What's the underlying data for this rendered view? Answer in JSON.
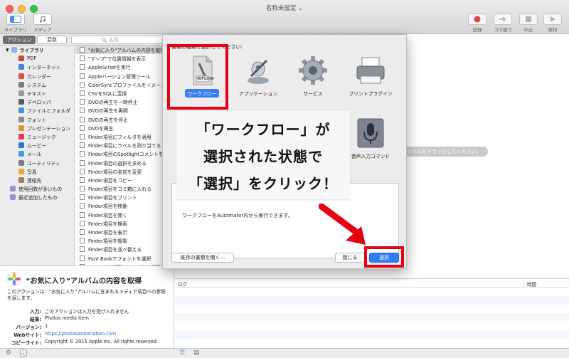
{
  "window": {
    "title": "名称未設定 ⌄",
    "left_buttons": [
      {
        "id": "library",
        "label": "ライブラリ"
      },
      {
        "id": "media",
        "label": "メディア"
      }
    ],
    "right_buttons": [
      {
        "id": "record",
        "label": "記録"
      },
      {
        "id": "step",
        "label": "コマ送り"
      },
      {
        "id": "stop",
        "label": "中止"
      },
      {
        "id": "run",
        "label": "実行"
      }
    ]
  },
  "sidebar": {
    "tabs": [
      {
        "label": "アクション",
        "active": true
      },
      {
        "label": "変数",
        "active": false
      }
    ],
    "search_placeholder": "名前",
    "root_category": "ライブラリ",
    "categories": [
      {
        "label": "PDF",
        "color": "#c94b3a"
      },
      {
        "label": "インターネット",
        "color": "#3d86d9"
      },
      {
        "label": "カレンダー",
        "color": "#e24b3e"
      },
      {
        "label": "システム",
        "color": "#7a7a7a"
      },
      {
        "label": "テキスト",
        "color": "#9a9a9a"
      },
      {
        "label": "デベロッパ",
        "color": "#5a5a5a"
      },
      {
        "label": "ファイルとフォルダ",
        "color": "#4a90d9"
      },
      {
        "label": "フォント",
        "color": "#8a8a8a"
      },
      {
        "label": "プレゼンテーション",
        "color": "#e8912d"
      },
      {
        "label": "ミュージック",
        "color": "#e6375d"
      },
      {
        "label": "ムービー",
        "color": "#2b6fd0"
      },
      {
        "label": "メール",
        "color": "#3c9be6"
      },
      {
        "label": "ユーティリティ",
        "color": "#7d7d7d"
      },
      {
        "label": "写真",
        "color": "#f3a32b"
      },
      {
        "label": "連絡先",
        "color": "#a67c52"
      }
    ],
    "footer_items": [
      {
        "label": "使用回数が多いもの"
      },
      {
        "label": "最近追加したもの"
      }
    ],
    "actions": [
      {
        "label": "\"お気に入り\"アルバムの内容を取得",
        "selected": true
      },
      {
        "label": "\"マップ\"で位置情報を表示"
      },
      {
        "label": "AppleScriptを実行"
      },
      {
        "label": "Appleバージョン管理ツール"
      },
      {
        "label": "ColorSyncプロファイルをイメージに"
      },
      {
        "label": "CSVをSQLに変換"
      },
      {
        "label": "DVDの再生を一時停止"
      },
      {
        "label": "DVDの再生を再開"
      },
      {
        "label": "DVDの再生を停止"
      },
      {
        "label": "DVDを再生"
      },
      {
        "label": "Finder項目にフィルタを適用"
      },
      {
        "label": "Finder項目にラベルを割り当てる"
      },
      {
        "label": "Finder項目のSpotlightコメントを"
      },
      {
        "label": "Finder項目の選択を求める"
      },
      {
        "label": "Finder項目の名前を変更"
      },
      {
        "label": "Finder項目をコピー"
      },
      {
        "label": "Finder項目をゴミ箱に入れる"
      },
      {
        "label": "Finder項目をプリント"
      },
      {
        "label": "Finder項目を移動"
      },
      {
        "label": "Finder項目を開く"
      },
      {
        "label": "Finder項目を検索"
      },
      {
        "label": "Finder項目を表示"
      },
      {
        "label": "Finder項目を複製"
      },
      {
        "label": "Finder項目を並べ替える"
      },
      {
        "label": "Font Bookでフォントを選択"
      },
      {
        "label": "Font Book項目にフィルタを適用"
      }
    ]
  },
  "description": {
    "title": "“お気に入り”アルバムの内容を取得",
    "body": "このアクションは、\"お気に入り\"アルバムに含まれるメディア項目への参照を返します。",
    "fields": [
      {
        "key": "入力:",
        "value": "このアクションは入力を受け入れません",
        "link": false
      },
      {
        "key": "結果:",
        "value": "Photos media item",
        "link": false
      },
      {
        "key": "バージョン:",
        "value": "1",
        "link": false
      },
      {
        "key": "Webサイト:",
        "value": "https://photosautomation.com",
        "link": true
      },
      {
        "key": "コピーライト:",
        "value": "Copyright © 2015 Apple Inc. All rights reserved.",
        "link": false
      }
    ]
  },
  "workflow": {
    "drag_hint": "ァイルをドラッグしてください。"
  },
  "log": {
    "col_log": "ログ",
    "col_time": "時間"
  },
  "dialog": {
    "prompt": "書類の種類を選択してください:",
    "types": [
      {
        "label": "ワークフロー",
        "selected": true,
        "icon": "workflow-icon"
      },
      {
        "label": "アプリケーション",
        "selected": false,
        "icon": "application-icon"
      },
      {
        "label": "サービス",
        "selected": false,
        "icon": "service-gear-icon"
      },
      {
        "label": "プリントプラグイン",
        "selected": false,
        "icon": "printer-icon"
      },
      {
        "label": "音声入力コマンド",
        "selected": false,
        "icon": "microphone-icon"
      }
    ],
    "workflow_badge": "WFLOW",
    "description": "ワークフローをAutomator内から実行できます。",
    "open_existing": "既存の書類を開く...",
    "close": "閉じる",
    "choose": "選択"
  },
  "annotation": {
    "lines": [
      "「ワークフロー」が",
      "選択された状態で",
      "「選択」をクリック！"
    ],
    "color": "#e60012"
  }
}
